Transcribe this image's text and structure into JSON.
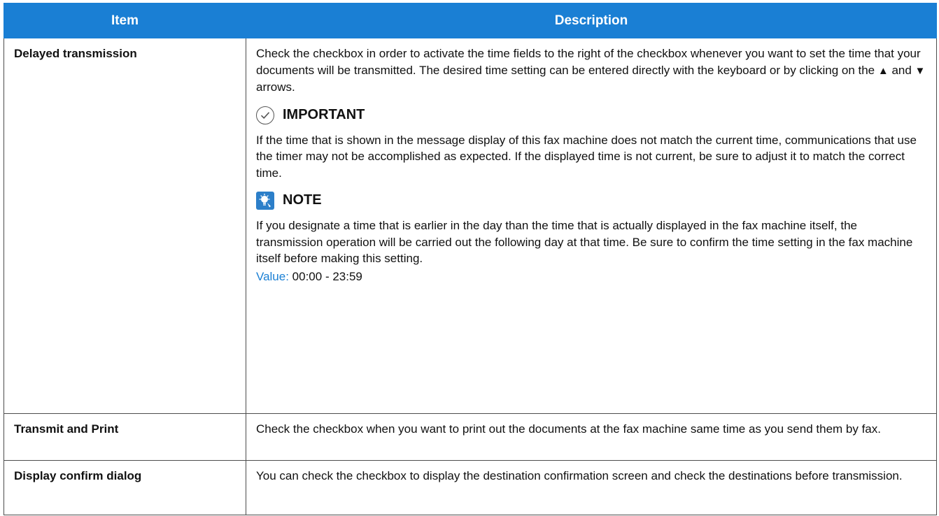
{
  "table": {
    "header": {
      "item": "Item",
      "description": "Description"
    },
    "rows": [
      {
        "item": "Delayed transmission",
        "paragraph_before_up": "Check the checkbox in order to activate the time fields to the right of the checkbox whenever you want to set the time that your documents will be transmitted. The desired time setting can be entered directly with the keyboard or by clicking on the ",
        "up_arrow": "▲",
        "and_text": " and ",
        "down_arrow": "▼",
        "paragraph_after_down": " arrows.",
        "important_label": "IMPORTANT",
        "important_text": "If the time that is shown in the message display of this fax machine does not match the current time, communications that use the timer may not be accomplished as expected. If the displayed time is not current, be sure to adjust it to match the correct time.",
        "note_label": "NOTE",
        "note_text": "If you designate a time that is earlier in the day than the time that is actually displayed in the fax machine itself, the transmission operation will be carried out the following day at that time. Be sure to confirm the time setting in the fax machine itself before making this setting.",
        "value_label": "Value:",
        "value_text": " 00:00 - 23:59"
      },
      {
        "item": "Transmit and Print",
        "description": "Check the checkbox when you want to print out the documents at the fax machine same time as you send them by fax."
      },
      {
        "item": "Display confirm dialog",
        "description": "You can check the checkbox to display the destination confirmation screen and check the destinations before transmission."
      }
    ]
  },
  "colors": {
    "header_bg": "#1a7fd4",
    "value_label": "#1a7fd4",
    "note_icon_bg": "#2c7fc9",
    "border": "#4d4d4d"
  },
  "icons": {
    "important": "check-circle-icon",
    "note": "lightbulb-icon"
  }
}
